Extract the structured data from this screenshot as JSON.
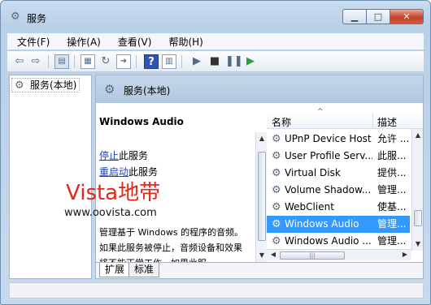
{
  "window": {
    "title": "服务",
    "caption_buttons": {
      "minimize": "▁",
      "maximize": "□",
      "close": "✕"
    }
  },
  "menu": [
    "文件(F)",
    "操作(A)",
    "查看(V)",
    "帮助(H)"
  ],
  "toolbar": {
    "buttons": [
      "back-icon",
      "forward-icon",
      "show-tree-icon",
      "properties-icon",
      "refresh-icon",
      "export-icon",
      "help-icon",
      "console-icon",
      "start-icon",
      "stop-icon",
      "pause-icon",
      "restart-icon"
    ]
  },
  "tree": {
    "root_label": "服务(本地)"
  },
  "right_header": {
    "title": "服务(本地)"
  },
  "details": {
    "service_name": "Windows Audio",
    "stop_link": "停止",
    "stop_suffix": "此服务",
    "restart_link": "重启动",
    "restart_suffix": "此服务",
    "watermark_line1": "Vista地带",
    "watermark_line2": "www.oovista.com",
    "description": "管理基于 Windows 的程序的音频。如果此服务被停止，音频设备和效果将不能正常工作。如果此服"
  },
  "list": {
    "columns": {
      "name": "名称",
      "description": "描述"
    },
    "rows": [
      {
        "name": "UPnP Device Host",
        "desc": "允许 ..."
      },
      {
        "name": "User Profile Serv...",
        "desc": "此服..."
      },
      {
        "name": "Virtual Disk",
        "desc": "提供..."
      },
      {
        "name": "Volume Shadow...",
        "desc": "管理..."
      },
      {
        "name": "WebClient",
        "desc": "使基..."
      },
      {
        "name": "Windows Audio",
        "desc": "管理..."
      },
      {
        "name": "Windows Audio ...",
        "desc": "管理..."
      }
    ],
    "selected_index": 5
  },
  "tabs": [
    "扩展",
    "标准"
  ],
  "colors": {
    "selection": "#3399ff",
    "watermark": "#e4281b",
    "link": "#1a3fb2"
  }
}
